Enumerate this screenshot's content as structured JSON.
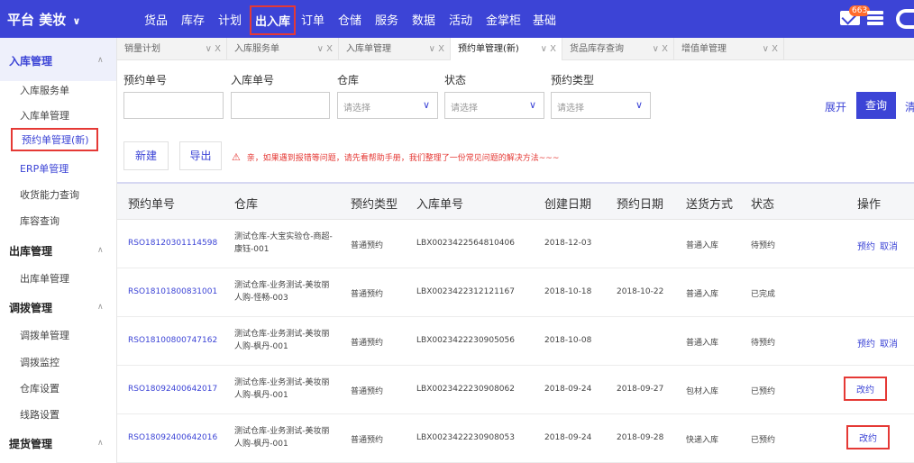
{
  "topbar": {
    "brand": "平台 美妆",
    "brand_caret": "∨",
    "nav": [
      "货品",
      "库存",
      "计划",
      "出入库",
      "订单",
      "仓储",
      "服务",
      "数据",
      "活动",
      "金掌柜",
      "基础"
    ],
    "active_nav": "出入库",
    "badge": "663"
  },
  "sidebar": {
    "groups": [
      {
        "label": "入库管理",
        "caret": "∧",
        "items": [
          "入库服务单",
          "入库单管理",
          "预约单管理(新)",
          "ERP单管理",
          "收货能力查询",
          "库容查询"
        ]
      },
      {
        "label": "出库管理",
        "caret": "∧",
        "items": [
          "出库单管理"
        ]
      },
      {
        "label": "调拨管理",
        "caret": "∧",
        "items": [
          "调拨单管理",
          "调拨监控",
          "仓库设置",
          "线路设置"
        ]
      },
      {
        "label": "提货管理",
        "caret": "∧",
        "items": []
      }
    ]
  },
  "tabs": [
    {
      "label": "销量计划",
      "ctrl": "∨ X"
    },
    {
      "label": "入库服务单",
      "ctrl": "∨ X"
    },
    {
      "label": "入库单管理",
      "ctrl": "∨ X"
    },
    {
      "label": "预约单管理(新)",
      "ctrl": "∨ X"
    },
    {
      "label": "货品库存查询",
      "ctrl": "∨ X"
    },
    {
      "label": "增值单管理",
      "ctrl": "∨ X"
    }
  ],
  "filters": {
    "labels": [
      "预约单号",
      "入库单号",
      "仓库",
      "状态",
      "预约类型"
    ],
    "placeholder": "请选择",
    "chevron": "∨",
    "expand": "展开",
    "query": "查询",
    "query_tail": "清"
  },
  "actions": {
    "new": "新建",
    "export": "导出",
    "notice_icon": "⚠",
    "notice": "亲，如果遇到报错等问题，请先看帮助手册，我们整理了一份常见问题的解决方法~~~"
  },
  "table": {
    "headers": [
      "预约单号",
      "仓库",
      "预约类型",
      "入库单号",
      "创建日期",
      "预约日期",
      "送货方式",
      "状态",
      "操作"
    ],
    "rows": [
      {
        "id": "RSO18120301114598",
        "warehouse": "测试仓库-大宝实验仓-商超-康钰-001",
        "type": "普通预约",
        "inbound": "LBX0023422564810406",
        "created": "2018-12-03",
        "appt": "",
        "delivery": "普通入库",
        "status": "待预约",
        "op1": "预约",
        "op2": "取消"
      },
      {
        "id": "RSO18101800831001",
        "warehouse": "测试仓库-业务测试-美妆丽人购-怪畅-003",
        "type": "普通预约",
        "inbound": "LBX0023422312121167",
        "created": "2018-10-18",
        "appt": "2018-10-22",
        "delivery": "普通入库",
        "status": "已完成",
        "op1": "",
        "op2": ""
      },
      {
        "id": "RSO18100800747162",
        "warehouse": "测试仓库-业务测试-美妆丽人购-枫丹-001",
        "type": "普通预约",
        "inbound": "LBX0023422230905056",
        "created": "2018-10-08",
        "appt": "",
        "delivery": "普通入库",
        "status": "待预约",
        "op1": "预约",
        "op2": "取消"
      },
      {
        "id": "RSO18092400642017",
        "warehouse": "测试仓库-业务测试-美妆丽人购-枫丹-001",
        "type": "普通预约",
        "inbound": "LBX0023422230908062",
        "created": "2018-09-24",
        "appt": "2018-09-27",
        "delivery": "包材入库",
        "status": "已预约",
        "op1": "改约",
        "op2": ""
      },
      {
        "id": "RSO18092400642016",
        "warehouse": "测试仓库-业务测试-美妆丽人购-枫丹-001",
        "type": "普通预约",
        "inbound": "LBX0023422230908053",
        "created": "2018-09-24",
        "appt": "2018-09-28",
        "delivery": "快递入库",
        "status": "已预约",
        "op1": "改约",
        "op2": ""
      }
    ]
  },
  "colors": {
    "primary": "#3c44d6",
    "highlight": "#e53935",
    "badge": "#ff6b2c"
  }
}
